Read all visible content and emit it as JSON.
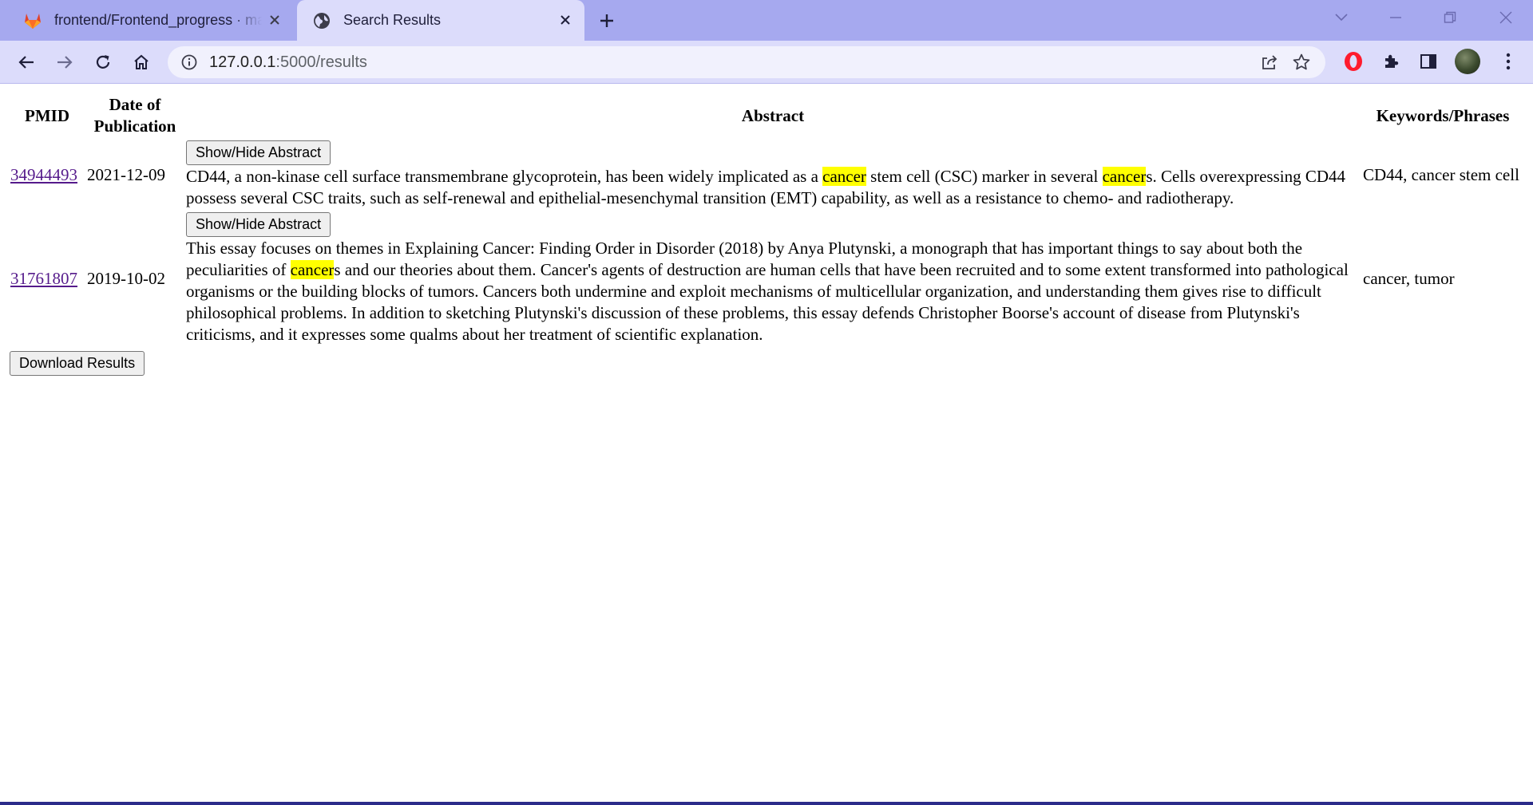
{
  "browser": {
    "tabs": [
      {
        "title": "frontend/Frontend_progress · main · ...",
        "icon": "gitlab-icon",
        "active": false
      },
      {
        "title": "Search Results",
        "icon": "globe-icon",
        "active": true
      }
    ],
    "url_host": "127.0.0.1",
    "url_path": ":5000/results"
  },
  "table": {
    "headers": {
      "pmid": "PMID",
      "date": "Date of Publication",
      "abstract": "Abstract",
      "keywords": "Keywords/Phrases"
    },
    "rows": [
      {
        "pmid": "34944493",
        "date": "2021-12-09",
        "toggle_label": "Show/Hide Abstract",
        "abstract_parts": [
          "CD44, a non-kinase cell surface transmembrane glycoprotein, has been widely implicated as a ",
          "cancer",
          " stem cell (CSC) marker in several ",
          "cancer",
          "s. Cells overexpressing CD44 possess several CSC traits, such as self-renewal and epithelial-mesenchymal transition (EMT) capability, as well as a resistance to chemo- and radiotherapy."
        ],
        "keywords": "CD44, cancer stem cell"
      },
      {
        "pmid": "31761807",
        "date": "2019-10-02",
        "toggle_label": "Show/Hide Abstract",
        "abstract_parts": [
          "This essay focuses on themes in Explaining Cancer: Finding Order in Disorder (2018) by Anya Plutynski, a monograph that has important things to say about both the peculiarities of ",
          "cancer",
          "s and our theories about them. Cancer's agents of destruction are human cells that have been recruited and to some extent transformed into pathological organisms or the building blocks of tumors. Cancers both undermine and exploit mechanisms of multicellular organization, and understanding them gives rise to difficult philosophical problems. In addition to sketching Plutynski's discussion of these problems, this essay defends Christopher Boorse's account of disease from Plutynski's criticisms, and it expresses some qualms about her treatment of scientific explanation."
        ],
        "keywords": "cancer, tumor"
      }
    ]
  },
  "download_label": "Download Results",
  "highlight_color": "#ffff00",
  "link_color": "#551a8b"
}
